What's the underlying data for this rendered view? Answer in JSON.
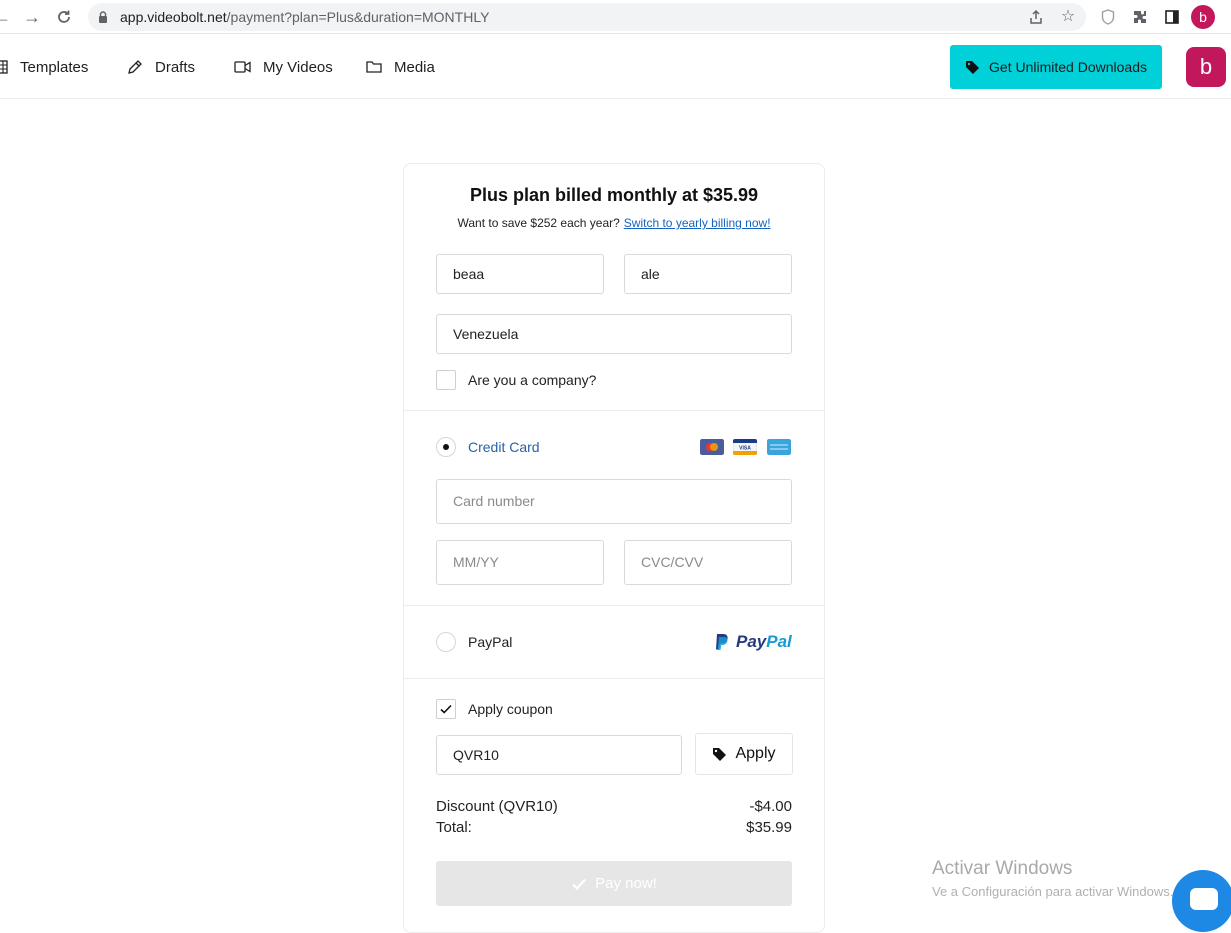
{
  "browser": {
    "url_host": "app.videobolt.net",
    "url_rest": "/payment?plan=Plus&duration=MONTHLY",
    "profile_initial": "b"
  },
  "header": {
    "nav": [
      {
        "label": "Templates",
        "icon": "grid-icon"
      },
      {
        "label": "Drafts",
        "icon": "pencil-icon"
      },
      {
        "label": "My Videos",
        "icon": "video-camera-icon"
      },
      {
        "label": "Media",
        "icon": "folder-icon"
      }
    ],
    "cta_label": "Get Unlimited Downloads",
    "avatar_initial": "b",
    "accent_color": "#00d1d8",
    "avatar_color": "#c2185b"
  },
  "payment": {
    "title": "Plus plan billed monthly at $35.99",
    "save_text": "Want to save $252 each year?",
    "switch_link": "Switch to yearly billing now!",
    "first_name": "beaa",
    "last_name": "ale",
    "country": "Venezuela",
    "company_label": "Are you a company?",
    "company_checked": false,
    "methods": {
      "credit_card_label": "Credit Card",
      "credit_card_selected": true,
      "card_number_placeholder": "Card number",
      "expiry_placeholder": "MM/YY",
      "cvc_placeholder": "CVC/CVV",
      "card_brands": [
        "mastercard-icon",
        "visa-icon",
        "amex-icon"
      ],
      "paypal_label": "PayPal",
      "paypal_logo_text": "PayPal",
      "paypal_selected": false
    },
    "coupon": {
      "label": "Apply coupon",
      "checked": true,
      "code": "QVR10",
      "apply_label": "Apply"
    },
    "summary": {
      "discount_label": "Discount (QVR10)",
      "discount_value": "-$4.00",
      "total_label": "Total:",
      "total_value": "$35.99"
    },
    "pay_label": "Pay now!"
  },
  "watermark": {
    "title": "Activar Windows",
    "subtitle": "Ve a Configuración para activar Windows."
  }
}
